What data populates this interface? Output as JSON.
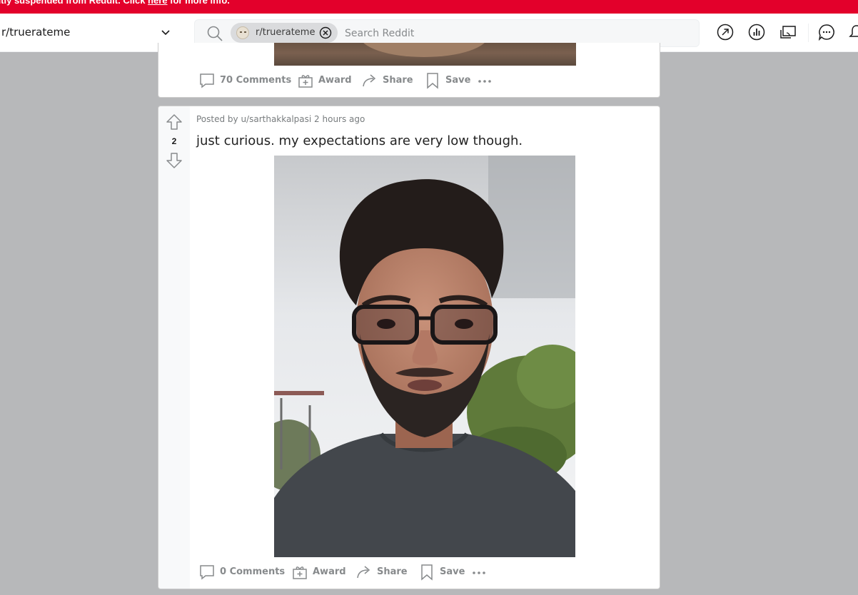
{
  "banner": {
    "text_before": "ently suspended from Reddit. Click ",
    "link_text": "here",
    "text_after": " for more info."
  },
  "header": {
    "community": "r/truerateme",
    "search": {
      "chip_label": "r/truerateme",
      "placeholder": "Search Reddit",
      "value": ""
    },
    "icons": [
      "popular-icon",
      "stats-icon",
      "video-icon",
      "chat-icon",
      "notification-icon"
    ]
  },
  "previous_post": {
    "actions": {
      "comments": "70 Comments",
      "award": "Award",
      "share": "Share",
      "save": "Save"
    }
  },
  "post": {
    "vote_count": "2",
    "meta": "Posted by u/sarthakkalpasi 2 hours ago",
    "title": "just curious. my expectations are very low though.",
    "actions": {
      "comments": "0 Comments",
      "award": "Award",
      "share": "Share",
      "save": "Save"
    }
  },
  "colors": {
    "banner": "#e3002b",
    "page_bg": "#b7b8ba",
    "action_text": "#878a8c"
  }
}
